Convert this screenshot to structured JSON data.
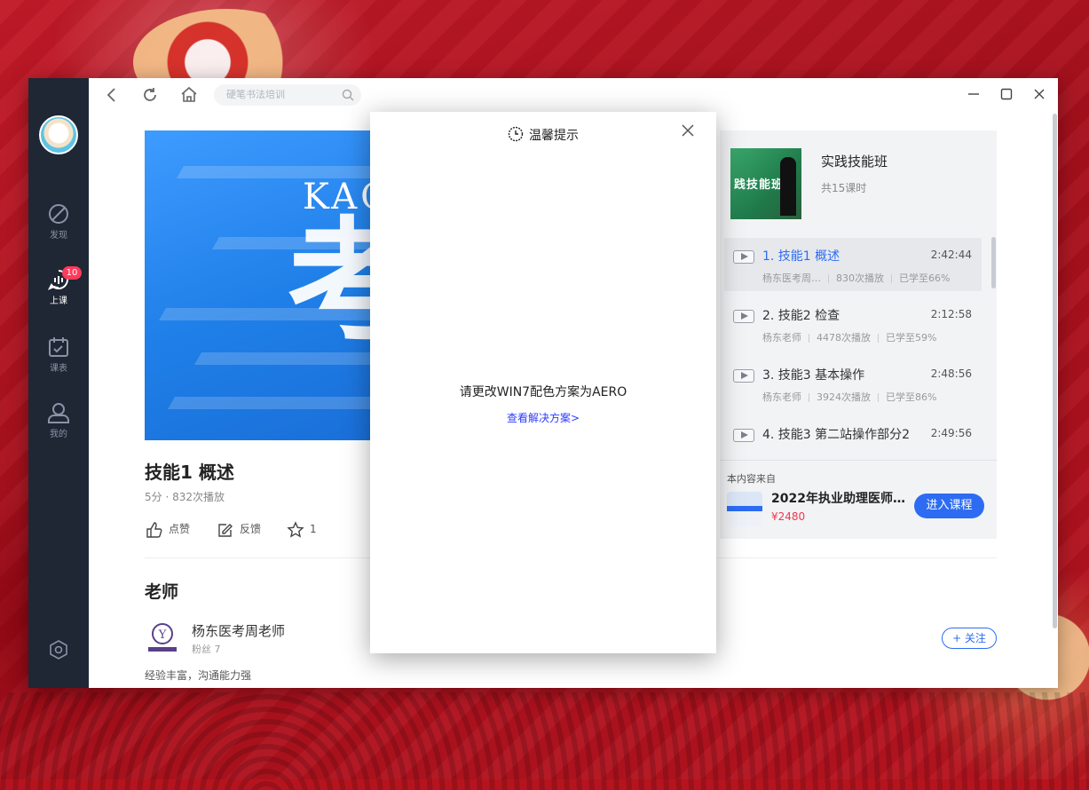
{
  "nav": {
    "items": [
      {
        "label": "发现"
      },
      {
        "label": "上课",
        "badge": "10"
      },
      {
        "label": "课表"
      },
      {
        "label": "我的"
      }
    ]
  },
  "toolbar": {
    "search_placeholder": "硬笔书法培训"
  },
  "hero": {
    "brand_text": "KAO",
    "big_char": "考"
  },
  "course": {
    "title": "技能1 概述",
    "meta": "5分 · 832次播放",
    "like_label": "点赞",
    "feedback_label": "反馈",
    "favorite_count": "1"
  },
  "teacher": {
    "section_title": "老师",
    "name": "杨东医考周老师",
    "fans": "粉丝 7",
    "description": "经验丰富，沟通能力强",
    "follow_label": "+ 关注"
  },
  "playlist": {
    "name": "实践技能班",
    "count": "共15课时",
    "cover_text": "践技能班",
    "lessons": [
      {
        "title": "1. 技能1 概述",
        "duration": "2:42:44",
        "teacher": "杨东医考周…",
        "plays": "830次播放",
        "progress": "已学至66%",
        "current": true
      },
      {
        "title": "2. 技能2 检查",
        "duration": "2:12:58",
        "teacher": "杨东老师",
        "plays": "4478次播放",
        "progress": "已学至59%"
      },
      {
        "title": "3. 技能3 基本操作",
        "duration": "2:48:56",
        "teacher": "杨东老师",
        "plays": "3924次播放",
        "progress": "已学至86%"
      },
      {
        "title": "4. 技能3 第二站操作部分2",
        "duration": "2:49:56",
        "teacher": "",
        "plays": "",
        "progress": ""
      }
    ],
    "source_label": "本内容来自",
    "source_name": "2022年执业助理医师…",
    "source_price": "¥2480",
    "enter_label": "进入课程"
  },
  "modal": {
    "title": "温馨提示",
    "message": "请更改WIN7配色方案为AERO",
    "link": "查看解决方案>"
  },
  "colors": {
    "accent": "#2d6cf2",
    "sidebar": "#1f2634",
    "badge": "#ff3b5c",
    "price": "#f2384f"
  }
}
